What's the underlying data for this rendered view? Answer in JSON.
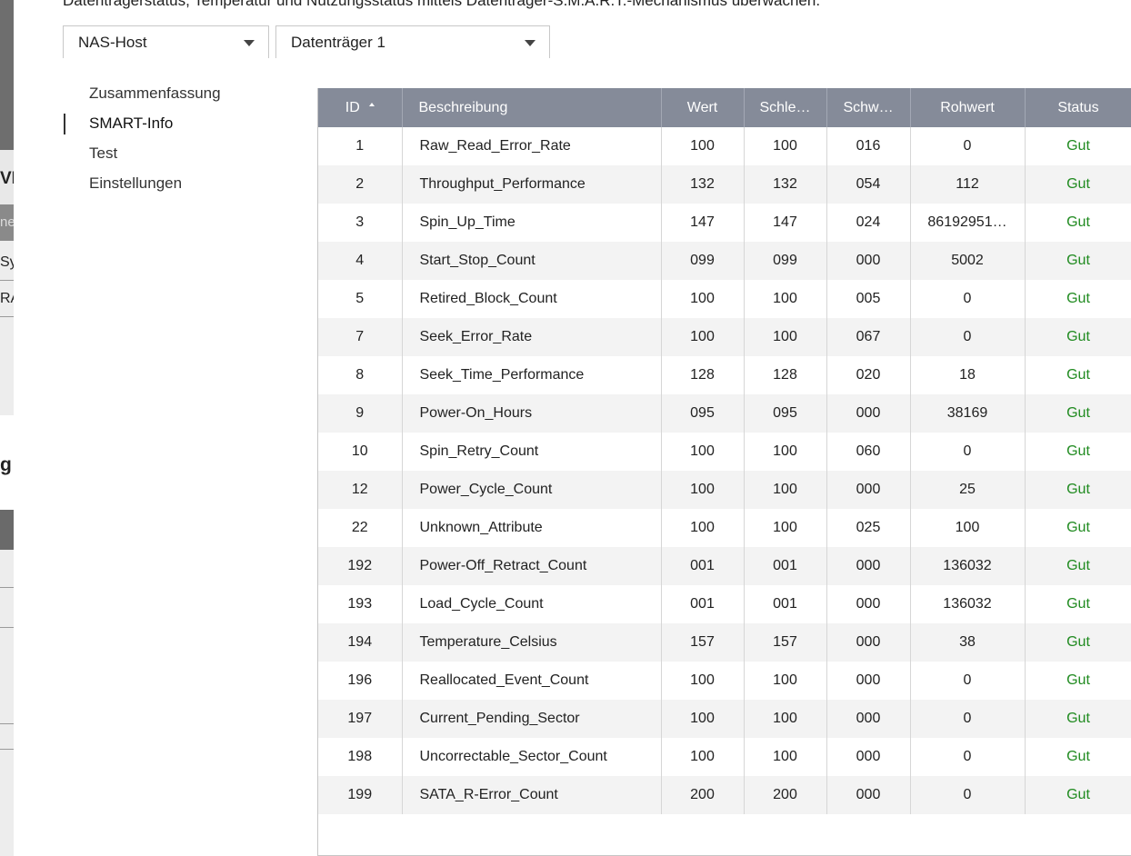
{
  "background": {
    "fragments": [
      "VL",
      "ne/",
      "Sy",
      "RA",
      "g"
    ]
  },
  "description": "Datenträgerstatus, Temperatur und Nutzungsstatus mittels Datenträger-S.M.A.R.T.-Mechanismus überwachen.",
  "selects": {
    "host": "NAS-Host",
    "disk": "Datenträger 1"
  },
  "nav": {
    "items": [
      {
        "label": "Zusammenfassung"
      },
      {
        "label": "SMART-Info"
      },
      {
        "label": "Test"
      },
      {
        "label": "Einstellungen"
      }
    ]
  },
  "table": {
    "headers": {
      "id": "ID",
      "desc": "Beschreibung",
      "value": "Wert",
      "worst": "Schle…",
      "thresh": "Schw…",
      "raw": "Rohwert",
      "status": "Status"
    },
    "rows": [
      {
        "id": "1",
        "desc": "Raw_Read_Error_Rate",
        "value": "100",
        "worst": "100",
        "thresh": "016",
        "raw": "0",
        "status": "Gut"
      },
      {
        "id": "2",
        "desc": "Throughput_Performance",
        "value": "132",
        "worst": "132",
        "thresh": "054",
        "raw": "112",
        "status": "Gut"
      },
      {
        "id": "3",
        "desc": "Spin_Up_Time",
        "value": "147",
        "worst": "147",
        "thresh": "024",
        "raw": "86192951…",
        "status": "Gut"
      },
      {
        "id": "4",
        "desc": "Start_Stop_Count",
        "value": "099",
        "worst": "099",
        "thresh": "000",
        "raw": "5002",
        "status": "Gut"
      },
      {
        "id": "5",
        "desc": "Retired_Block_Count",
        "value": "100",
        "worst": "100",
        "thresh": "005",
        "raw": "0",
        "status": "Gut"
      },
      {
        "id": "7",
        "desc": "Seek_Error_Rate",
        "value": "100",
        "worst": "100",
        "thresh": "067",
        "raw": "0",
        "status": "Gut"
      },
      {
        "id": "8",
        "desc": "Seek_Time_Performance",
        "value": "128",
        "worst": "128",
        "thresh": "020",
        "raw": "18",
        "status": "Gut"
      },
      {
        "id": "9",
        "desc": "Power-On_Hours",
        "value": "095",
        "worst": "095",
        "thresh": "000",
        "raw": "38169",
        "status": "Gut"
      },
      {
        "id": "10",
        "desc": "Spin_Retry_Count",
        "value": "100",
        "worst": "100",
        "thresh": "060",
        "raw": "0",
        "status": "Gut"
      },
      {
        "id": "12",
        "desc": "Power_Cycle_Count",
        "value": "100",
        "worst": "100",
        "thresh": "000",
        "raw": "25",
        "status": "Gut"
      },
      {
        "id": "22",
        "desc": "Unknown_Attribute",
        "value": "100",
        "worst": "100",
        "thresh": "025",
        "raw": "100",
        "status": "Gut"
      },
      {
        "id": "192",
        "desc": "Power-Off_Retract_Count",
        "value": "001",
        "worst": "001",
        "thresh": "000",
        "raw": "136032",
        "status": "Gut"
      },
      {
        "id": "193",
        "desc": "Load_Cycle_Count",
        "value": "001",
        "worst": "001",
        "thresh": "000",
        "raw": "136032",
        "status": "Gut"
      },
      {
        "id": "194",
        "desc": "Temperature_Celsius",
        "value": "157",
        "worst": "157",
        "thresh": "000",
        "raw": "38",
        "status": "Gut"
      },
      {
        "id": "196",
        "desc": "Reallocated_Event_Count",
        "value": "100",
        "worst": "100",
        "thresh": "000",
        "raw": "0",
        "status": "Gut"
      },
      {
        "id": "197",
        "desc": "Current_Pending_Sector",
        "value": "100",
        "worst": "100",
        "thresh": "000",
        "raw": "0",
        "status": "Gut"
      },
      {
        "id": "198",
        "desc": "Uncorrectable_Sector_Count",
        "value": "100",
        "worst": "100",
        "thresh": "000",
        "raw": "0",
        "status": "Gut"
      },
      {
        "id": "199",
        "desc": "SATA_R-Error_Count",
        "value": "200",
        "worst": "200",
        "thresh": "000",
        "raw": "0",
        "status": "Gut"
      }
    ]
  },
  "colors": {
    "header_bg": "#858b99",
    "status_good": "#1f8a1f",
    "row_alt": "#f3f3f3"
  }
}
